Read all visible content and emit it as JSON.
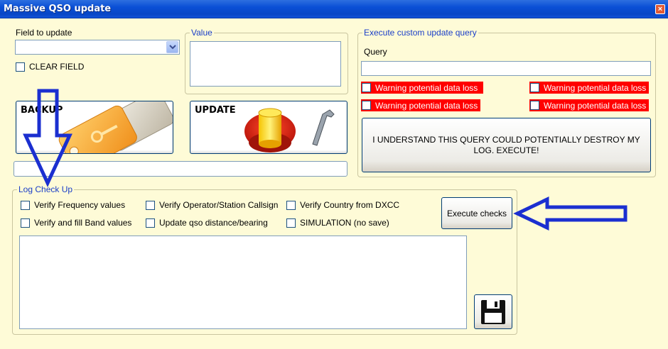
{
  "window": {
    "title": "Massive QSO update",
    "close_label": "×"
  },
  "field_update": {
    "label": "Field to update",
    "selected": "",
    "clear_label": "CLEAR FIELD"
  },
  "value_group": {
    "legend": "Value",
    "value": ""
  },
  "buttons": {
    "backup_label": "BACKUP",
    "update_label": "UPDATE"
  },
  "progress_text": "",
  "custom_query": {
    "legend": "Execute custom update query",
    "query_label": "Query",
    "query_value": "",
    "warnings": [
      "Warning potential data loss",
      "Warning potential data loss",
      "Warning potential data loss",
      "Warning potential data loss"
    ],
    "execute_label": "I UNDERSTAND THIS QUERY COULD POTENTIALLY DESTROY MY LOG. EXECUTE!"
  },
  "log_check": {
    "legend": "Log Check Up",
    "options": [
      "Verify Frequency values",
      "Verify Operator/Station Callsign",
      "Verify Country from DXCC",
      "Verify and fill Band values",
      "Update qso distance/bearing",
      "SIMULATION (no save)"
    ],
    "execute_label": "Execute checks",
    "output": ""
  },
  "icons": [
    "keys-icon",
    "database-tools-icon",
    "floppy-disk-icon",
    "arrow-down-annotation",
    "arrow-left-annotation"
  ],
  "colors": {
    "window_bg": "#fefbd7",
    "title_bar": "#0a4fd6",
    "legend_text": "#1a3ec8",
    "warning_bg": "#ff0000",
    "annotation_arrow": "#1b2fd0"
  }
}
